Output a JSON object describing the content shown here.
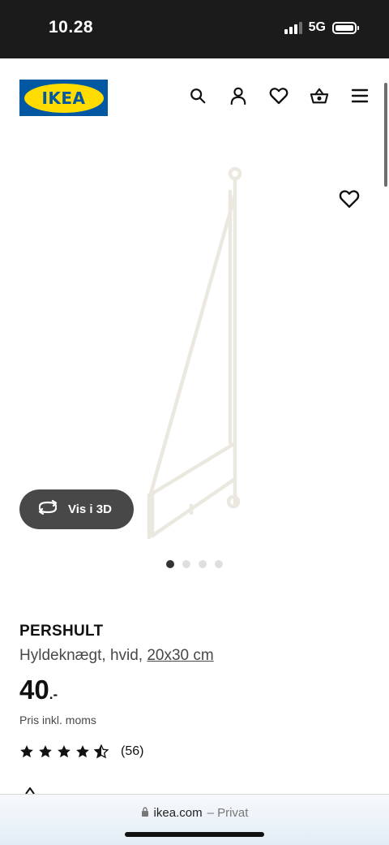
{
  "status_bar": {
    "time": "10.28",
    "network": "5G",
    "icons": [
      "signal-icon",
      "battery-icon"
    ]
  },
  "header": {
    "logo_text": "IKEA",
    "icons": [
      "search-icon",
      "account-icon",
      "heart-icon",
      "basket-icon",
      "menu-icon"
    ]
  },
  "gallery": {
    "view_3d_label": "Vis i 3D",
    "dot_count": 4,
    "active_dot": 0
  },
  "product": {
    "name": "PERSHULT",
    "description": "Hyldeknægt, hvid,",
    "size": "20x30 cm",
    "price": "40",
    "price_suffix": ".-",
    "price_note": "Pris inkl. moms",
    "rating": 4.5,
    "rating_max": 5,
    "review_count": "(56)"
  },
  "browser": {
    "domain": "ikea.com",
    "mode": "– Privat"
  },
  "colors": {
    "ikea_blue": "#0058a3",
    "ikea_yellow": "#ffdb00",
    "status_bar": "#1b1b1b",
    "button_dark": "#484848",
    "dot_active": "#333333",
    "dot_inactive": "#dfdfdf"
  }
}
